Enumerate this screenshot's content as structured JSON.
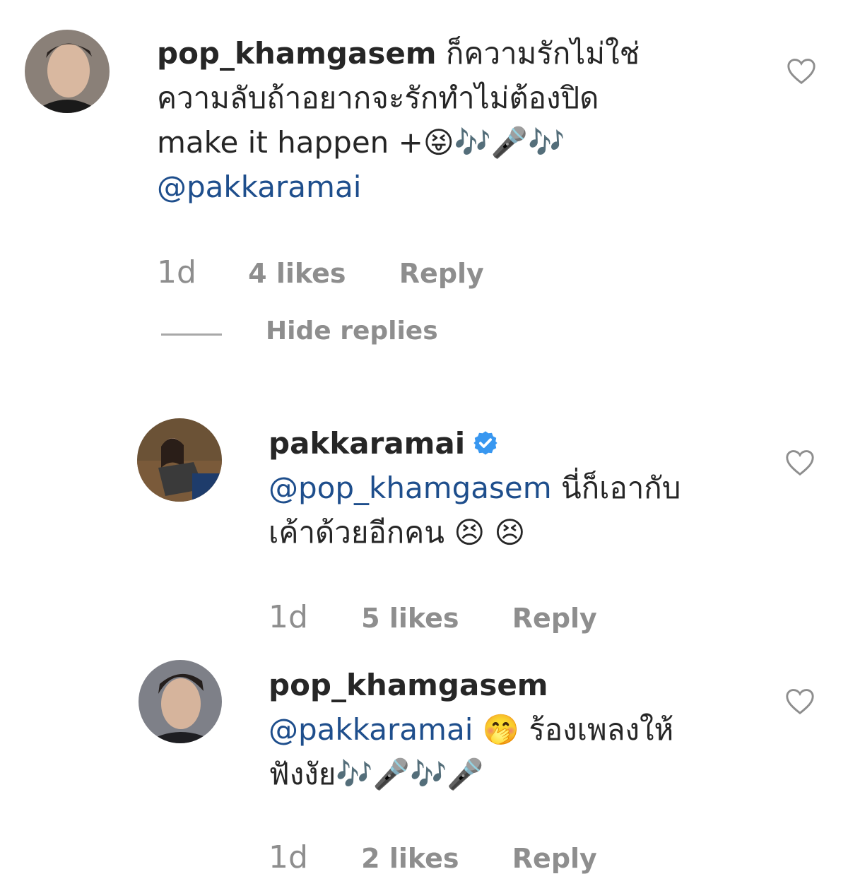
{
  "comments": [
    {
      "username": "pop_khamgasem",
      "text_line1": " ก็ความรักไม่ใช่",
      "text_line2": "ความลับถ้าอยากจะรักทำไม่ต้องปิด",
      "text_line3": "make it happen +😝🎶🎤🎶",
      "mention": "@pakkaramai",
      "time": "1d",
      "likes": "4 likes",
      "reply_label": "Reply",
      "hide_replies_label": "Hide replies"
    },
    {
      "username": "pakkaramai",
      "verified_icon": "verified-badge-icon",
      "mention": "@pop_khamgasem",
      "text_line1": " นี่ก็เอากับ",
      "text_line2": "เค้าด้วยอีกคน 😣 😣",
      "time": "1d",
      "likes": "5 likes",
      "reply_label": "Reply"
    },
    {
      "username": "pop_khamgasem",
      "mention": "@pakkaramai",
      "text_line1": " 🤭 ร้องเพลงให้",
      "text_line2": "ฟังงัย🎶🎤🎶🎤",
      "time": "1d",
      "likes": "2 likes",
      "reply_label": "Reply"
    }
  ],
  "icons": {
    "like": "heart-outline-icon",
    "verified": "verified-badge-icon"
  },
  "colors": {
    "mention": "#1e4e8c",
    "meta": "#8e8e8e",
    "verified": "#3897f0"
  }
}
